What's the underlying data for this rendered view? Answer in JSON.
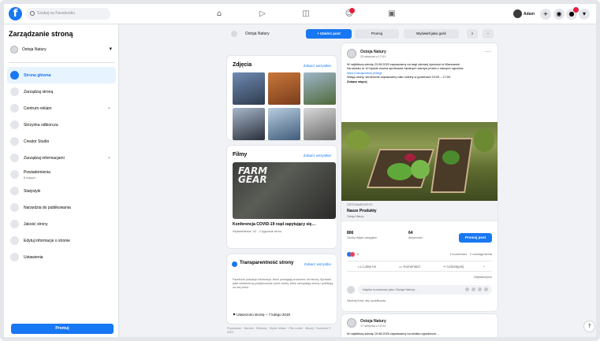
{
  "topbar": {
    "search_placeholder": "Szukaj na Facebooku",
    "user_name": "Adam",
    "notifications_badge": "1"
  },
  "sidebar": {
    "title": "Zarządzanie stroną",
    "page_name": "Ostoja Natury",
    "items": [
      {
        "label": "Strona główna",
        "active": true
      },
      {
        "label": "Zarządzaj stroną"
      },
      {
        "label": "Centrum reklam",
        "chevron": true
      },
      {
        "label": "Skrzynka odbiorcza"
      },
      {
        "label": "Creator Studio"
      },
      {
        "label": "Zarządzaj informacjami",
        "chevron": true
      },
      {
        "label": "Powiadomienia",
        "sub": "8 nowych"
      },
      {
        "label": "Statystyki"
      },
      {
        "label": "Narzędzia do publikowania"
      },
      {
        "label": "Jakość strony"
      },
      {
        "label": "Edytuj informacje o stronie"
      },
      {
        "label": "Ustawienia"
      }
    ],
    "promote_label": "Promuj"
  },
  "actionbar": {
    "page_name": "Ostoja Natury",
    "btn_post": "+ Utwórz post",
    "btn_promote": "Promuj",
    "btn_visit": "Wyświetl jako gość"
  },
  "photos": {
    "title": "Zdjęcia",
    "link": "Zobacz wszystkie"
  },
  "videos": {
    "title": "Filmy",
    "link": "Zobacz wszystkie",
    "thumb_text_1": "FARM",
    "thumb_text_2": "GEAR",
    "video_title": "Konferencja COVID-19 rząd zapytujący się…",
    "video_meta": "Wyświetlenia: 42 · 2 tygodnie temu"
  },
  "transparency": {
    "title": "Transparentność strony",
    "link": "Zobacz wszystko",
    "text": "Facebook pokazuje informacje, które pomagają zrozumieć cel strony. Sprawdź, jakie działania są podejmowane przez osoby, które zarządzają stroną i publikują na niej treści.",
    "created": "Utworzono stronę – 7 lutego 2018"
  },
  "footer": "Prywatność · Warunki · Reklamy · Wybór reklam · Pliki cookie · Więcej · Facebook © 2020",
  "post": {
    "page_name": "Ostoja Natury",
    "date": "23 sierpnia o 17:01",
    "text_1": "W najbliższą sobotę 23.08.2020 zapraszamy na targi zdrowej żywności w Warszawie.",
    "text_2": "Na stoisku nr 12 będzie można spróbować lokalnych warzyw prosto z naszych ogrodów.",
    "link_text": "https://ostojanatury.pl/targi",
    "text_3": "Wstęp wolny, serdecznie zapraszamy całe rodziny w godzinach 10:00 – 17:00.",
    "see_more": "Zobacz więcej",
    "link_caption": "OSTOJANATURY.PL",
    "link_title": "Nasze Produkty",
    "link_desc": "Ostoja Natury",
    "stats": [
      {
        "value": "806",
        "label": "Osoby objęte zasięgiem"
      },
      {
        "value": "64",
        "label": "Aktywności"
      }
    ],
    "boost_label": "Promuj post",
    "reactions_count": "8",
    "comments_count": "1 komentarz · 2 udostępnienia",
    "action_like": "Lubię to!",
    "action_comment": "Komentarz",
    "action_share": "Udostępnij",
    "comment_mode": "Najtrafniejsze",
    "comment_placeholder": "Napisz komentarz jako Ostoja Natury…",
    "press_enter": "Naciśnij Enter, aby opublikować."
  },
  "post2": {
    "page_name": "Ostoja Natury",
    "date": "17 sierpnia o 10:24",
    "text": "W najbliższą sobotę 19.08.2020 zapraszamy na stoisko ogrodnicze…"
  },
  "colors": {
    "accent": "#1877f2",
    "background": "#f0f2f5",
    "badge": "#e41e3f"
  }
}
